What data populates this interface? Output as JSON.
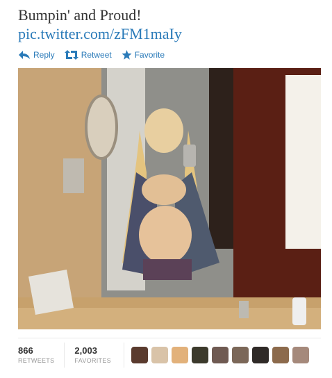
{
  "tweet": {
    "text": "Bumpin' and Proud!",
    "link": "pic.twitter.com/zFM1maIy"
  },
  "actions": {
    "reply": "Reply",
    "retweet": "Retweet",
    "favorite": "Favorite"
  },
  "stats": {
    "retweets_count": "866",
    "retweets_label": "RETWEETS",
    "favorites_count": "2,003",
    "favorites_label": "FAVORITES"
  },
  "avatars": [
    {
      "color": "#5a3b2e"
    },
    {
      "color": "#d9c3a8"
    },
    {
      "color": "#e2b17a"
    },
    {
      "color": "#3c3a2c"
    },
    {
      "color": "#6f5a52"
    },
    {
      "color": "#7b6758"
    },
    {
      "color": "#2f2a27"
    },
    {
      "color": "#8c6a4c"
    },
    {
      "color": "#a5897b"
    }
  ],
  "colors": {
    "link": "#2b7bb9",
    "text": "#333333",
    "muted": "#999999"
  },
  "icons": [
    "reply-icon",
    "retweet-icon",
    "star-icon"
  ]
}
